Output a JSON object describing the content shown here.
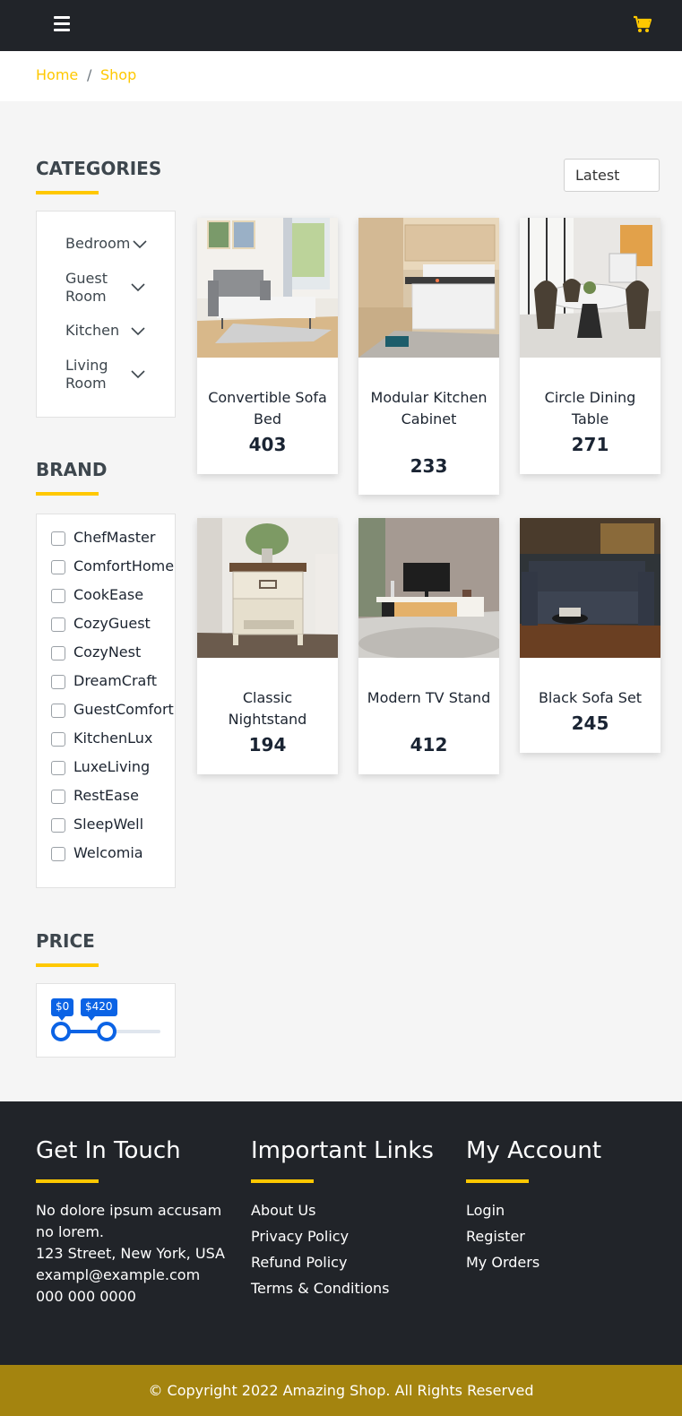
{
  "header": {
    "menu_icon": "hamburger-icon",
    "cart_icon": "shopping-cart-icon"
  },
  "breadcrumb": {
    "home": "Home",
    "separator": "/",
    "current": "Shop"
  },
  "sort": {
    "selected": "Latest"
  },
  "categories": {
    "title": "CATEGORIES",
    "items": [
      {
        "label": "Bedroom"
      },
      {
        "label": "Guest Room"
      },
      {
        "label": "Kitchen"
      },
      {
        "label": "Living Room"
      }
    ]
  },
  "brand": {
    "title": "BRAND",
    "items": [
      "ChefMaster",
      "ComfortHome",
      "CookEase",
      "CozyGuest",
      "CozyNest",
      "DreamCraft",
      "GuestComfort",
      "KitchenLux",
      "LuxeLiving",
      "RestEase",
      "SleepWell",
      "Welcomia"
    ]
  },
  "price": {
    "title": "PRICE",
    "min_label": "$0",
    "max_label": "$420",
    "min_value": 0,
    "max_value": 420
  },
  "products": [
    {
      "name": "Convertible Sofa Bed",
      "price": "403"
    },
    {
      "name": "Modular Kitchen Cabinet",
      "price": "233"
    },
    {
      "name": "Circle Dining Table",
      "price": "271"
    },
    {
      "name": "Classic Nightstand",
      "price": "194"
    },
    {
      "name": "Modern TV Stand",
      "price": "412"
    },
    {
      "name": "Black Sofa Set",
      "price": "245"
    }
  ],
  "footer": {
    "touch": {
      "title": "Get In Touch",
      "line1": "No dolore ipsum accusam no lorem.",
      "address": "123 Street, New York, USA",
      "email": "exampl@example.com",
      "phone": "000 000 0000"
    },
    "links": {
      "title": "Important Links",
      "items": [
        "About Us",
        "Privacy Policy",
        "Refund Policy",
        "Terms & Conditions"
      ]
    },
    "account": {
      "title": "My Account",
      "items": [
        "Login",
        "Register",
        "My Orders"
      ]
    },
    "copyright": "© Copyright 2022 Amazing Shop. All Rights Reserved"
  },
  "colors": {
    "accent": "#ffc800",
    "dark": "#212429",
    "slider": "#0b63e5",
    "copyright_bg": "#a4840f"
  }
}
